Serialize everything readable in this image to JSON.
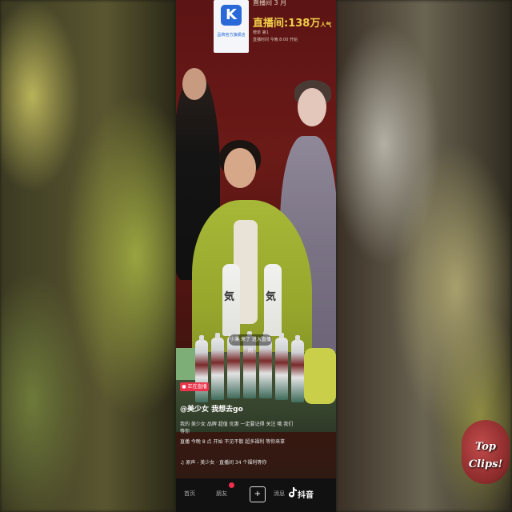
{
  "header": {
    "top_strip": "直播间 3 月",
    "live_count": "直播间:138",
    "live_count_unit": "万",
    "live_count_suffix": "人气",
    "info_line_1": "榜单 第1",
    "info_line_2": "直播时间 今晚 8:00 开始"
  },
  "logo": {
    "glyph": "K",
    "text": "品牌官方旗舰店"
  },
  "scene": {
    "bottle_text": "気"
  },
  "entry_toast": "小溪 来了 进入直播间",
  "tag": "● 正在直播",
  "username": "@美少女 我想去go",
  "caption": {
    "line1": "我的 美少女 品牌 超值 优惠 一定要记得 关注 哦 我们",
    "line2": "等你",
    "line3": "直播 今晚 8 点 开始 不见不散 超多福利 等你来拿"
  },
  "music": "♫ 原声 - 美少女 · 直播间 34 个福利等你",
  "nav": {
    "home": "首页",
    "friends": "朋友",
    "plus": "+",
    "messages": "消息",
    "brand": "抖音"
  },
  "watermark": {
    "line1": "Top",
    "line2": "Clips!"
  },
  "colors": {
    "accent_red": "#e9344b",
    "count_yellow": "#f3d04a",
    "logo_blue": "#2a6ad8"
  }
}
